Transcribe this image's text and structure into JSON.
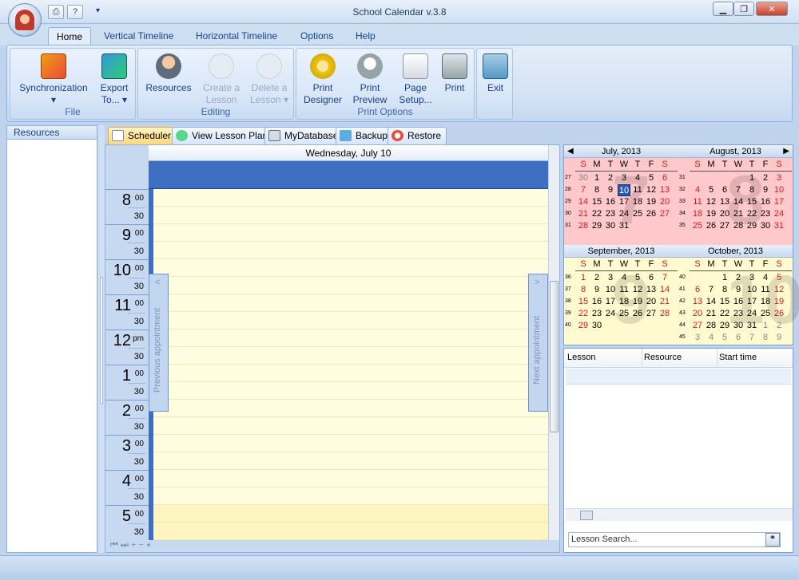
{
  "window": {
    "title": "School Calendar v.3.8"
  },
  "quick_access": {
    "print_icon": "printer-icon",
    "help_icon": "help-icon",
    "menu_arrow": "▾"
  },
  "window_controls": {
    "minimize": "▁",
    "restore": "❐",
    "close": "✕"
  },
  "ribbon_tabs": [
    "Home",
    "Vertical Timeline",
    "Horizontal Timeline",
    "Options",
    "Help"
  ],
  "ribbon": {
    "file": {
      "label": "File",
      "sync_line1": "Synchronization",
      "sync_line2": "▾",
      "export_line1": "Export",
      "export_line2": "To... ▾"
    },
    "editing": {
      "label": "Editing",
      "resources": "Resources",
      "create_line1": "Create a",
      "create_line2": "Lesson",
      "delete_line1": "Delete a",
      "delete_line2": "Lesson ▾"
    },
    "print_options": {
      "label": "Print Options",
      "designer_line1": "Print",
      "designer_line2": "Designer",
      "preview_line1": "Print",
      "preview_line2": "Preview",
      "page_line1": "Page",
      "page_line2": "Setup...",
      "print": "Print"
    },
    "exit": {
      "label": "Exit"
    }
  },
  "left_panel": {
    "title": "Resources"
  },
  "view_tabs": [
    "Scheduler",
    "View Lesson Plans",
    "MyDatabase",
    "Backup",
    "Restore"
  ],
  "scheduler": {
    "date_header": "Wednesday, July 10",
    "prev_appointment": "Previous appointment",
    "next_appointment": "Next appointment",
    "hours": [
      {
        "h": "8",
        "m": "00",
        "half": "30"
      },
      {
        "h": "9",
        "m": "00",
        "half": "30"
      },
      {
        "h": "10",
        "m": "00",
        "half": "30"
      },
      {
        "h": "11",
        "m": "00",
        "half": "30"
      },
      {
        "h": "12",
        "m": "pm",
        "half": "30"
      },
      {
        "h": "1",
        "m": "00",
        "half": "30"
      },
      {
        "h": "2",
        "m": "00",
        "half": "30"
      },
      {
        "h": "3",
        "m": "00",
        "half": "30"
      },
      {
        "h": "4",
        "m": "00",
        "half": "30"
      },
      {
        "h": "5",
        "m": "00",
        "half": "30"
      }
    ],
    "footer_nav": "⏮ ⏭ + − ◂",
    "prev_arrow": "<",
    "next_arrow": ">"
  },
  "calendar": {
    "dow": [
      "S",
      "M",
      "T",
      "W",
      "T",
      "F",
      "S"
    ],
    "months": [
      {
        "title": "July, 2013",
        "bg": "7",
        "theme": "pink",
        "weeks": [
          "27",
          "28",
          "29",
          "30",
          "31"
        ],
        "days": [
          [
            "30",
            "1",
            "2",
            "3",
            "4",
            "5",
            "6"
          ],
          [
            "7",
            "8",
            "9",
            "10",
            "11",
            "12",
            "13"
          ],
          [
            "14",
            "15",
            "16",
            "17",
            "18",
            "19",
            "20"
          ],
          [
            "21",
            "22",
            "23",
            "24",
            "25",
            "26",
            "27"
          ],
          [
            "28",
            "29",
            "30",
            "31",
            "",
            "",
            ""
          ]
        ]
      },
      {
        "title": "August, 2013",
        "bg": "8",
        "theme": "pink",
        "weeks": [
          "31",
          "32",
          "33",
          "34",
          "35"
        ],
        "days": [
          [
            "",
            "",
            "",
            "",
            "1",
            "2",
            "3"
          ],
          [
            "4",
            "5",
            "6",
            "7",
            "8",
            "9",
            "10"
          ],
          [
            "11",
            "12",
            "13",
            "14",
            "15",
            "16",
            "17"
          ],
          [
            "18",
            "19",
            "20",
            "21",
            "22",
            "23",
            "24"
          ],
          [
            "25",
            "26",
            "27",
            "28",
            "29",
            "30",
            "31"
          ]
        ]
      },
      {
        "title": "September, 2013",
        "bg": "9",
        "theme": "yellow",
        "weeks": [
          "36",
          "37",
          "38",
          "39",
          "40"
        ],
        "days": [
          [
            "1",
            "2",
            "3",
            "4",
            "5",
            "6",
            "7"
          ],
          [
            "8",
            "9",
            "10",
            "11",
            "12",
            "13",
            "14"
          ],
          [
            "15",
            "16",
            "17",
            "18",
            "19",
            "20",
            "21"
          ],
          [
            "22",
            "23",
            "24",
            "25",
            "26",
            "27",
            "28"
          ],
          [
            "29",
            "30",
            "",
            "",
            "",
            "",
            ""
          ]
        ]
      },
      {
        "title": "October, 2013",
        "bg": "10",
        "theme": "yellow",
        "weeks": [
          "40",
          "41",
          "42",
          "43",
          "44",
          "45"
        ],
        "days": [
          [
            "",
            "",
            "1",
            "2",
            "3",
            "4",
            "5"
          ],
          [
            "6",
            "7",
            "8",
            "9",
            "10",
            "11",
            "12"
          ],
          [
            "13",
            "14",
            "15",
            "16",
            "17",
            "18",
            "19"
          ],
          [
            "20",
            "21",
            "22",
            "23",
            "24",
            "25",
            "26"
          ],
          [
            "27",
            "28",
            "29",
            "30",
            "31",
            "1",
            "2"
          ],
          [
            "3",
            "4",
            "5",
            "6",
            "7",
            "8",
            "9"
          ]
        ]
      }
    ],
    "today": "10",
    "nav_prev": "◀",
    "nav_next": "▶"
  },
  "lesson_list": {
    "columns": [
      "Lesson",
      "Resource",
      "Start time"
    ],
    "search_placeholder": "Lesson Search...",
    "search_icon": "binoculars-icon"
  }
}
